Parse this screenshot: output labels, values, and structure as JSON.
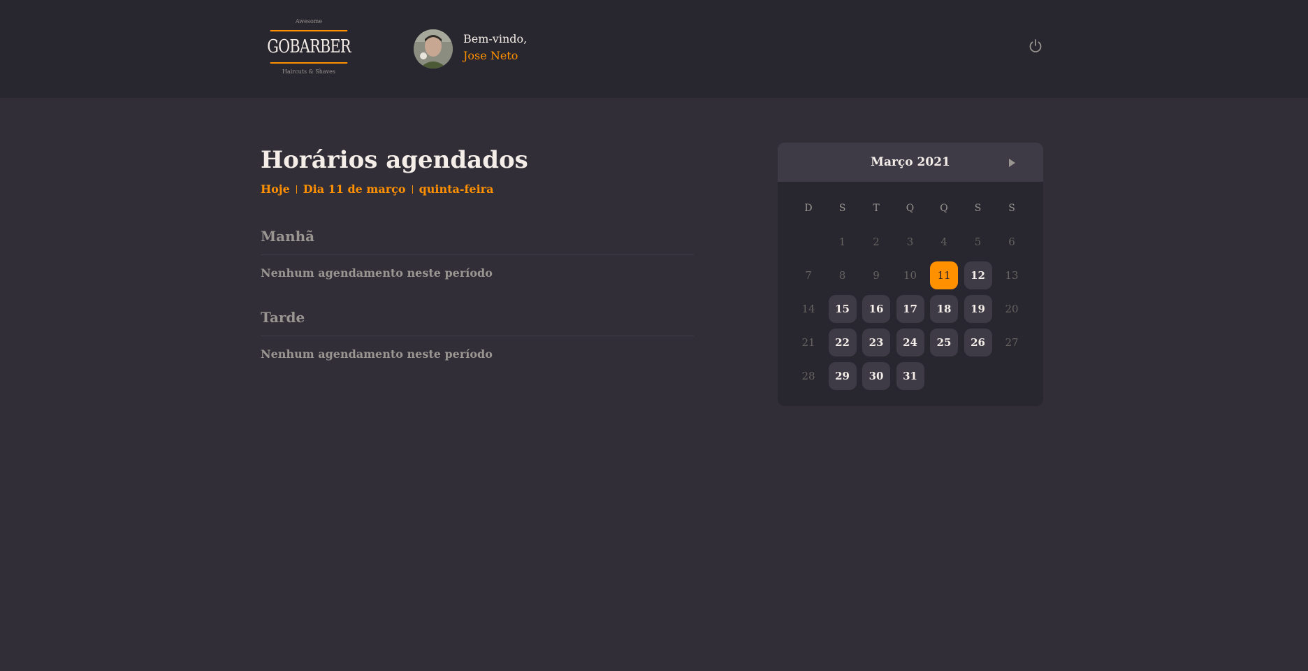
{
  "header": {
    "logo": {
      "top": "Awesome",
      "wordmark": "GOBARBER",
      "bottom": "Haircuts & Shaves"
    },
    "welcome": "Bem-vindo,",
    "user_name": "Jose Neto",
    "power_icon": "power-icon"
  },
  "schedule": {
    "title": "Horários agendados",
    "today": "Hoje",
    "date": "Dia 11 de março",
    "weekday": "quinta-feira",
    "sections": [
      {
        "title": "Manhã",
        "empty": "Nenhum agendamento neste período"
      },
      {
        "title": "Tarde",
        "empty": "Nenhum agendamento neste período"
      }
    ]
  },
  "calendar": {
    "month": "Março 2021",
    "weekdays": [
      "D",
      "S",
      "T",
      "Q",
      "Q",
      "S",
      "S"
    ],
    "first_weekday": 1,
    "days_in_month": 31,
    "selected_day": 11,
    "available_days": [
      12,
      15,
      16,
      17,
      18,
      19,
      22,
      23,
      24,
      25,
      26,
      29,
      30,
      31
    ]
  },
  "colors": {
    "accent": "#ff9000",
    "background": "#312e38",
    "header": "#28262e",
    "surface": "#3e3b47"
  }
}
